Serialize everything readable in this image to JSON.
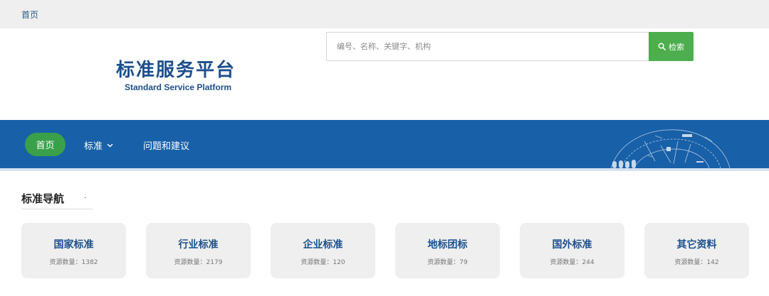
{
  "breadcrumb": {
    "home": "首页"
  },
  "logo": {
    "cn": "标准服务平台",
    "en": "Standard Service Platform"
  },
  "search": {
    "placeholder": "编号、名称、关键字、机构",
    "button_label": "检索",
    "icon": "search-icon"
  },
  "nav": {
    "home": "首页",
    "standards": "标准",
    "feedback": "问题和建议"
  },
  "section": {
    "title": "标准导航",
    "dot": "."
  },
  "categories": [
    {
      "title": "国家标准",
      "count": "资源数量：1382"
    },
    {
      "title": "行业标准",
      "count": "资源数量：2179"
    },
    {
      "title": "企业标准",
      "count": "资源数量：120"
    },
    {
      "title": "地标团标",
      "count": "资源数量：79"
    },
    {
      "title": "国外标准",
      "count": "资源数量：244"
    },
    {
      "title": "其它资料",
      "count": "资源数量：142"
    }
  ],
  "colors": {
    "brand": "#1d4f8c",
    "nav_bg": "#1860a8",
    "accent_green": "#4cae4c"
  }
}
